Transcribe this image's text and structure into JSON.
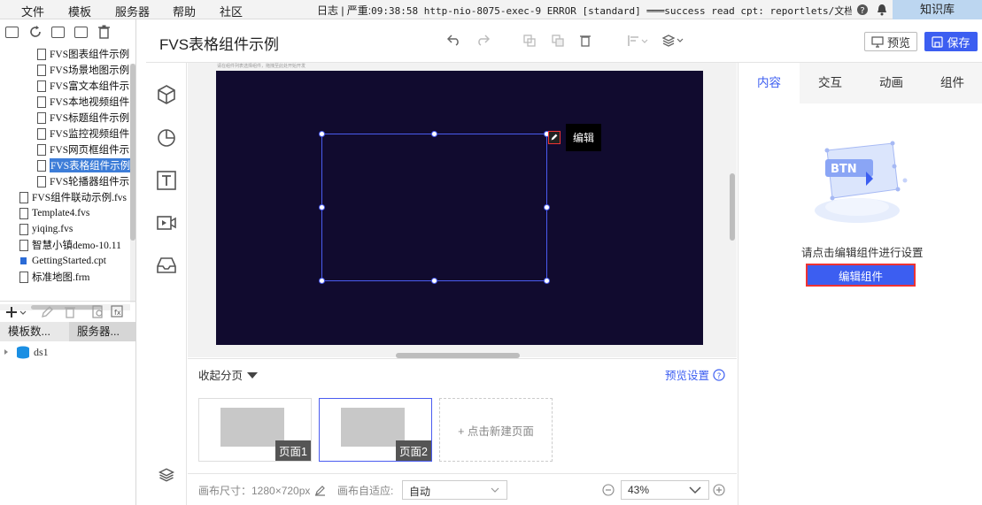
{
  "menubar": {
    "items": [
      "文件",
      "模板",
      "服务器",
      "帮助",
      "社区"
    ],
    "status_prefix": "日志 | 严重:",
    "status_text": "09:38:58 http-nio-8075-exec-9 ERROR [standard] ═══success read cpt: reportlets/文档...",
    "knowledge_base": "知识库"
  },
  "file_tree": {
    "items": [
      {
        "label": "FVS图表组件示例",
        "selected": false
      },
      {
        "label": "FVS场景地图示例",
        "selected": false
      },
      {
        "label": "FVS富文本组件示",
        "selected": false
      },
      {
        "label": "FVS本地视频组件",
        "selected": false
      },
      {
        "label": "FVS标题组件示例",
        "selected": false
      },
      {
        "label": "FVS监控视频组件",
        "selected": false
      },
      {
        "label": "FVS网页框组件示",
        "selected": false
      },
      {
        "label": "FVS表格组件示例",
        "selected": true
      },
      {
        "label": "FVS轮播器组件示",
        "selected": false
      },
      {
        "label": "FVS组件联动示例.fvs",
        "selected": false
      },
      {
        "label": "Template4.fvs",
        "selected": false
      },
      {
        "label": "yiqing.fvs",
        "selected": false
      },
      {
        "label": "智慧小镇demo-10.11",
        "selected": false
      },
      {
        "label": "GettingStarted.cpt",
        "selected": false
      },
      {
        "label": "标准地图.frm",
        "selected": false
      }
    ]
  },
  "datasource": {
    "tabs": [
      "模板数...",
      "服务器..."
    ],
    "item": "ds1"
  },
  "editor": {
    "title": "FVS表格组件示例",
    "preview": "预览",
    "save": "保存"
  },
  "canvas": {
    "hint": "请在组件列表选择组件，拖拽至此处开始开发",
    "edit_tooltip": "编辑"
  },
  "pages": {
    "collapse": "收起分页",
    "preview_settings": "预览设置",
    "items": [
      "页面1",
      "页面2"
    ],
    "new_page": "+ 点击新建页面"
  },
  "bottombar": {
    "canvas_size": "画布尺寸：1280×720px",
    "fit_label": "画布自适应:",
    "fit_value": "自动",
    "zoom": "43%"
  },
  "right_panel": {
    "tabs": [
      "内容",
      "交互",
      "动画",
      "组件"
    ],
    "active_tab": "内容",
    "illustration_text": "BTN",
    "hint": "请点击编辑组件进行设置",
    "edit_button": "编辑组件"
  },
  "colors": {
    "accent": "#3c5ef1",
    "canvas_bg": "#110b2f",
    "highlight_red": "#e33"
  }
}
